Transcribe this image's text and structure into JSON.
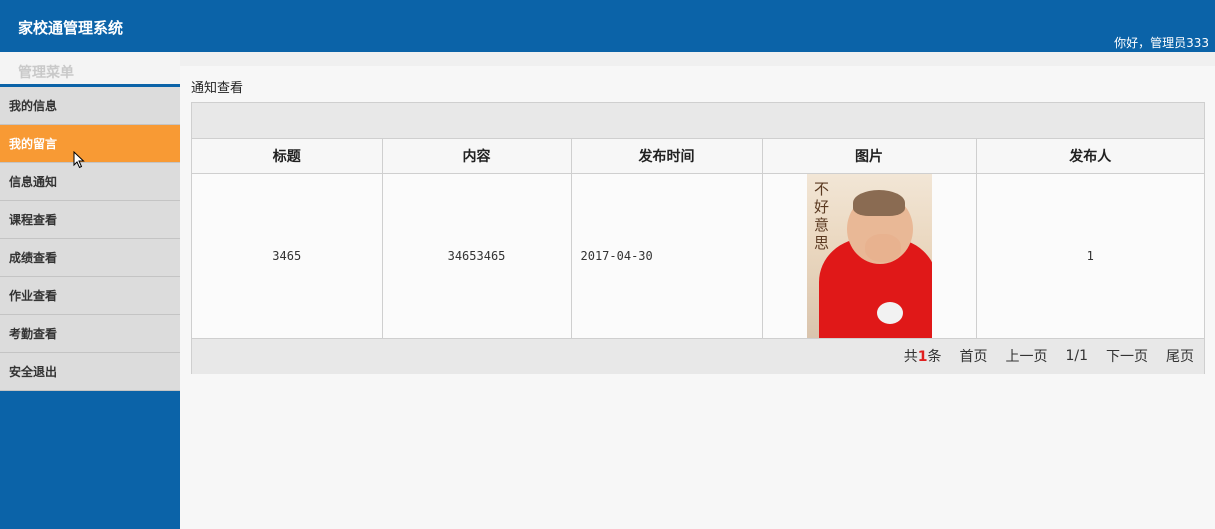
{
  "header": {
    "app_title": "家校通管理系统",
    "greeting": "你好，管理员333"
  },
  "sidebar": {
    "menu_title": "管理菜单",
    "items": [
      {
        "label": "我的信息",
        "active": false
      },
      {
        "label": "我的留言",
        "active": true
      },
      {
        "label": "信息通知",
        "active": false
      },
      {
        "label": "课程查看",
        "active": false
      },
      {
        "label": "成绩查看",
        "active": false
      },
      {
        "label": "作业查看",
        "active": false
      },
      {
        "label": "考勤查看",
        "active": false
      },
      {
        "label": "安全退出",
        "active": false
      }
    ]
  },
  "main": {
    "page_title": "通知查看",
    "table": {
      "columns": [
        "标题",
        "内容",
        "发布时间",
        "图片",
        "发布人"
      ],
      "rows": [
        {
          "title": "3465",
          "content": "34653465",
          "time": "2017-04-30",
          "image_caption": "不好意思",
          "publisher": "1"
        }
      ]
    },
    "pager": {
      "count_prefix": "共",
      "count": "1",
      "count_suffix": "条",
      "first": "首页",
      "prev": "上一页",
      "page": "1/1",
      "next": "下一页",
      "last": "尾页"
    }
  },
  "colors": {
    "header_bg": "#0b63a8",
    "active_menu": "#f89a34",
    "count_highlight": "#e02020"
  }
}
